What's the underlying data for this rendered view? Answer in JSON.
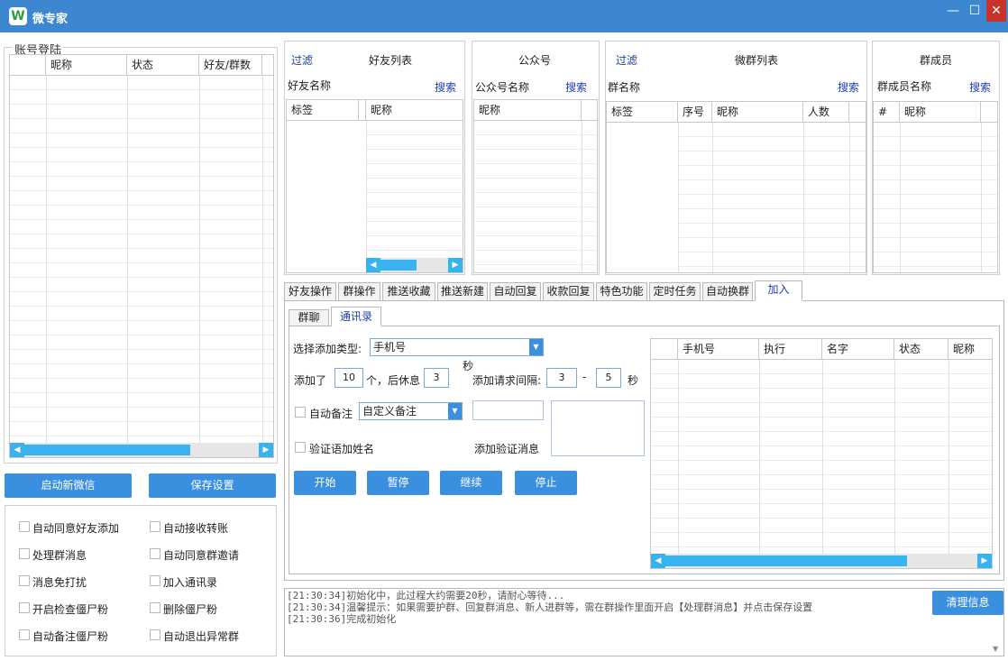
{
  "window": {
    "title": "微专家",
    "logo": "W",
    "minimize": "—",
    "maximize": "☐",
    "close": "✕"
  },
  "account": {
    "legend": "账号登陆",
    "columns": [
      "昵称",
      "状态",
      "好友/群数"
    ],
    "start_button": "启动新微信",
    "save_button": "保存设置",
    "options": [
      "自动同意好友添加",
      "自动接收转账",
      "处理群消息",
      "自动同意群邀请",
      "消息免打扰",
      "加入通讯录",
      "开启检查僵尸粉",
      "删除僵尸粉",
      "自动备注僵尸粉",
      "自动退出异常群"
    ]
  },
  "friends": {
    "filter": "过滤",
    "title": "好友列表",
    "name_label": "好友名称",
    "search": "搜索",
    "columns": [
      "标签",
      "昵称"
    ]
  },
  "official": {
    "title": "公众号",
    "name_label": "公众号名称",
    "search": "搜索",
    "columns": [
      "昵称"
    ]
  },
  "groups": {
    "filter": "过滤",
    "title": "微群列表",
    "name_label": "群名称",
    "search": "搜索",
    "columns": [
      "标签",
      "序号",
      "昵称",
      "人数"
    ]
  },
  "members": {
    "title": "群成员",
    "name_label": "群成员名称",
    "search": "搜索",
    "columns": [
      "#",
      "昵称"
    ]
  },
  "tabs": [
    "好友操作",
    "群操作",
    "推送收藏",
    "推送新建",
    "自动回复",
    "收款回复",
    "特色功能",
    "定时任务",
    "自动换群",
    "加入"
  ],
  "subtabs": [
    "群聊",
    "通讯录"
  ],
  "add_form": {
    "type_label": "选择添加类型:",
    "type_value": "手机号",
    "added_label": "添加了",
    "added_count": "10",
    "unit_ge": "个，后休息",
    "rest_value": "3",
    "sec_label": "秒",
    "interval_label": "添加请求间隔:",
    "interval_min": "3",
    "dash": "-",
    "interval_max": "5",
    "sec_label2": "秒",
    "auto_note_label": "自动备注",
    "note_select": "自定义备注",
    "verify_name_label": "验证语加姓名",
    "verify_msg_label": "添加验证消息",
    "buttons": [
      "开始",
      "暂停",
      "继续",
      "停止"
    ]
  },
  "contacts_grid": {
    "columns": [
      "手机号",
      "执行",
      "名字",
      "状态",
      "昵称"
    ]
  },
  "log": {
    "lines": [
      "[21:30:34]初始化中，此过程大约需要20秒，请耐心等待...",
      "[21:30:34]温馨提示：如果需要护群、回复群消息、新人进群等，需在群操作里面开启【处理群消息】并点击保存设置",
      "[21:30:36]完成初始化"
    ],
    "clear_button": "清理信息"
  },
  "colors": {
    "titlebar": "#3c87cf",
    "button": "#3b8fdf",
    "scroll": "#39b3f0",
    "link": "#1a3fa8"
  }
}
